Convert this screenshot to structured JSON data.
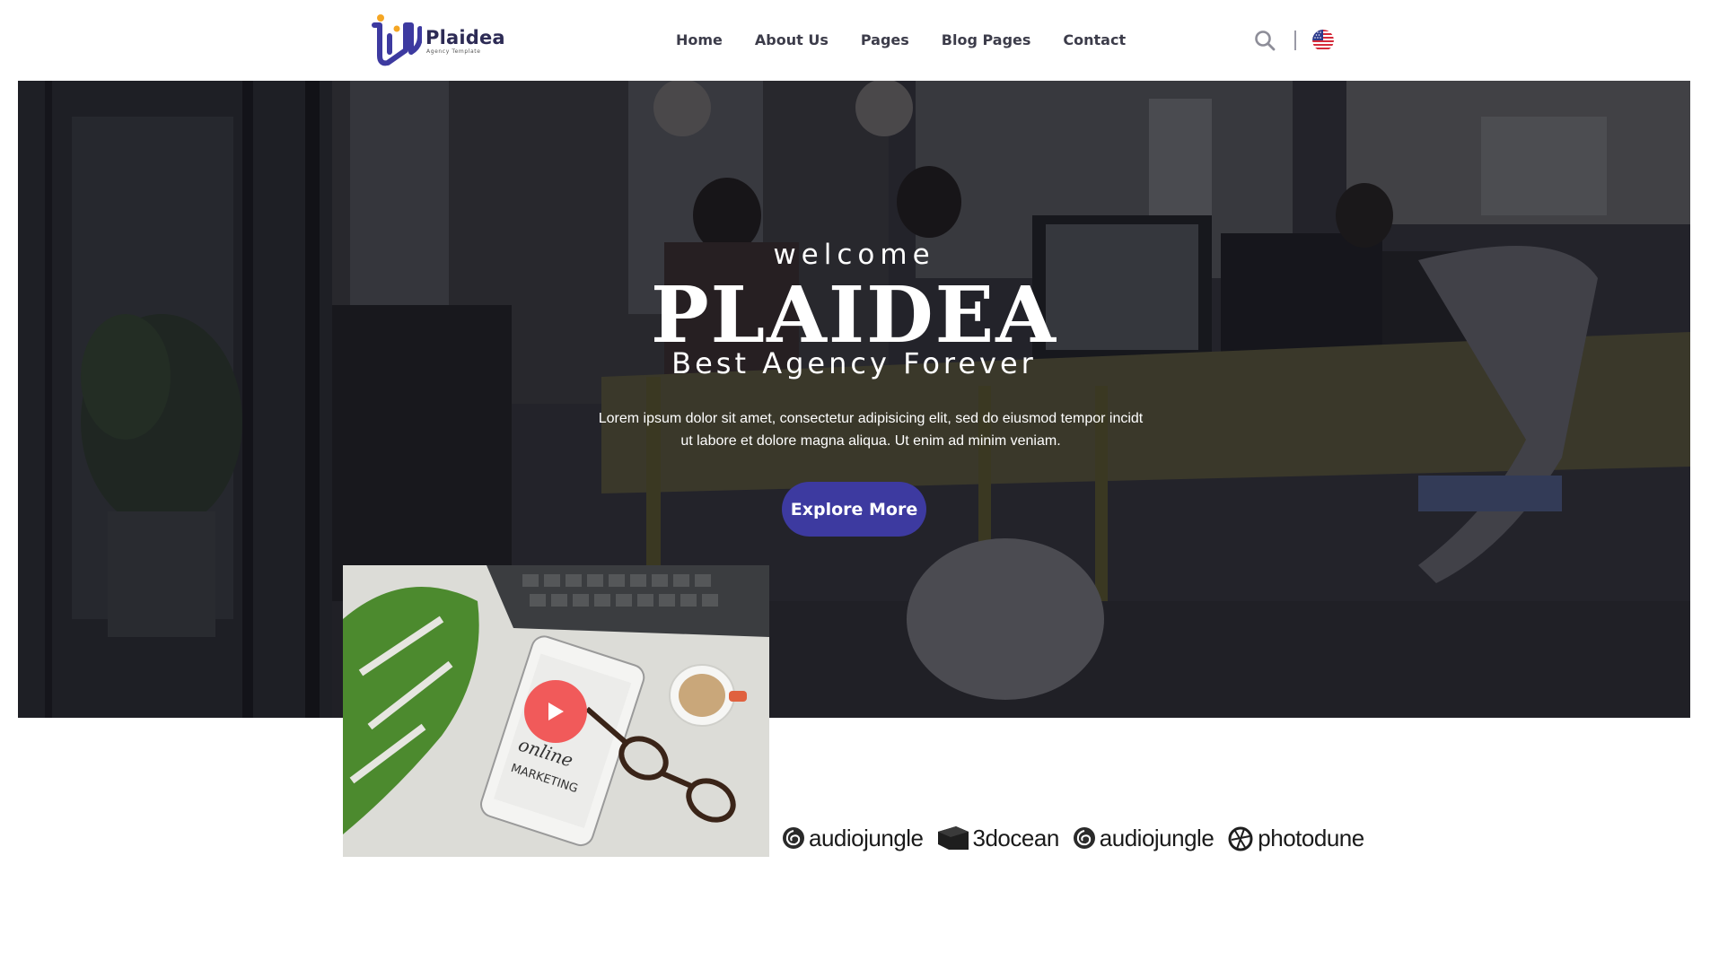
{
  "header": {
    "brand": "Plaidea",
    "brand_tagline": "Agency Template",
    "nav": [
      "Home",
      "About Us",
      "Pages",
      "Blog Pages",
      "Contact"
    ]
  },
  "hero": {
    "welcome": "welcome",
    "title": "PLAIDEA",
    "subtitle": "Best Agency Forever",
    "text_line1": "Lorem ipsum dolor sit amet, consectetur adipisicing elit, sed do eiusmod tempor incidt",
    "text_line2": "ut labore et dolore magna aliqua. Ut enim ad minim veniam.",
    "button": "Explore More"
  },
  "video": {
    "image_text_1": "online",
    "image_text_2": "MARKETING"
  },
  "partners": [
    "audiojungle",
    "3docean",
    "audiojungle",
    "photodune"
  ],
  "colors": {
    "brand_primary": "#3d3aa0",
    "play_button": "#f15a5a",
    "logo_accent": "#f5a623"
  },
  "icons": {
    "search": "search-icon",
    "language": "us-flag-icon",
    "play": "play-icon"
  }
}
